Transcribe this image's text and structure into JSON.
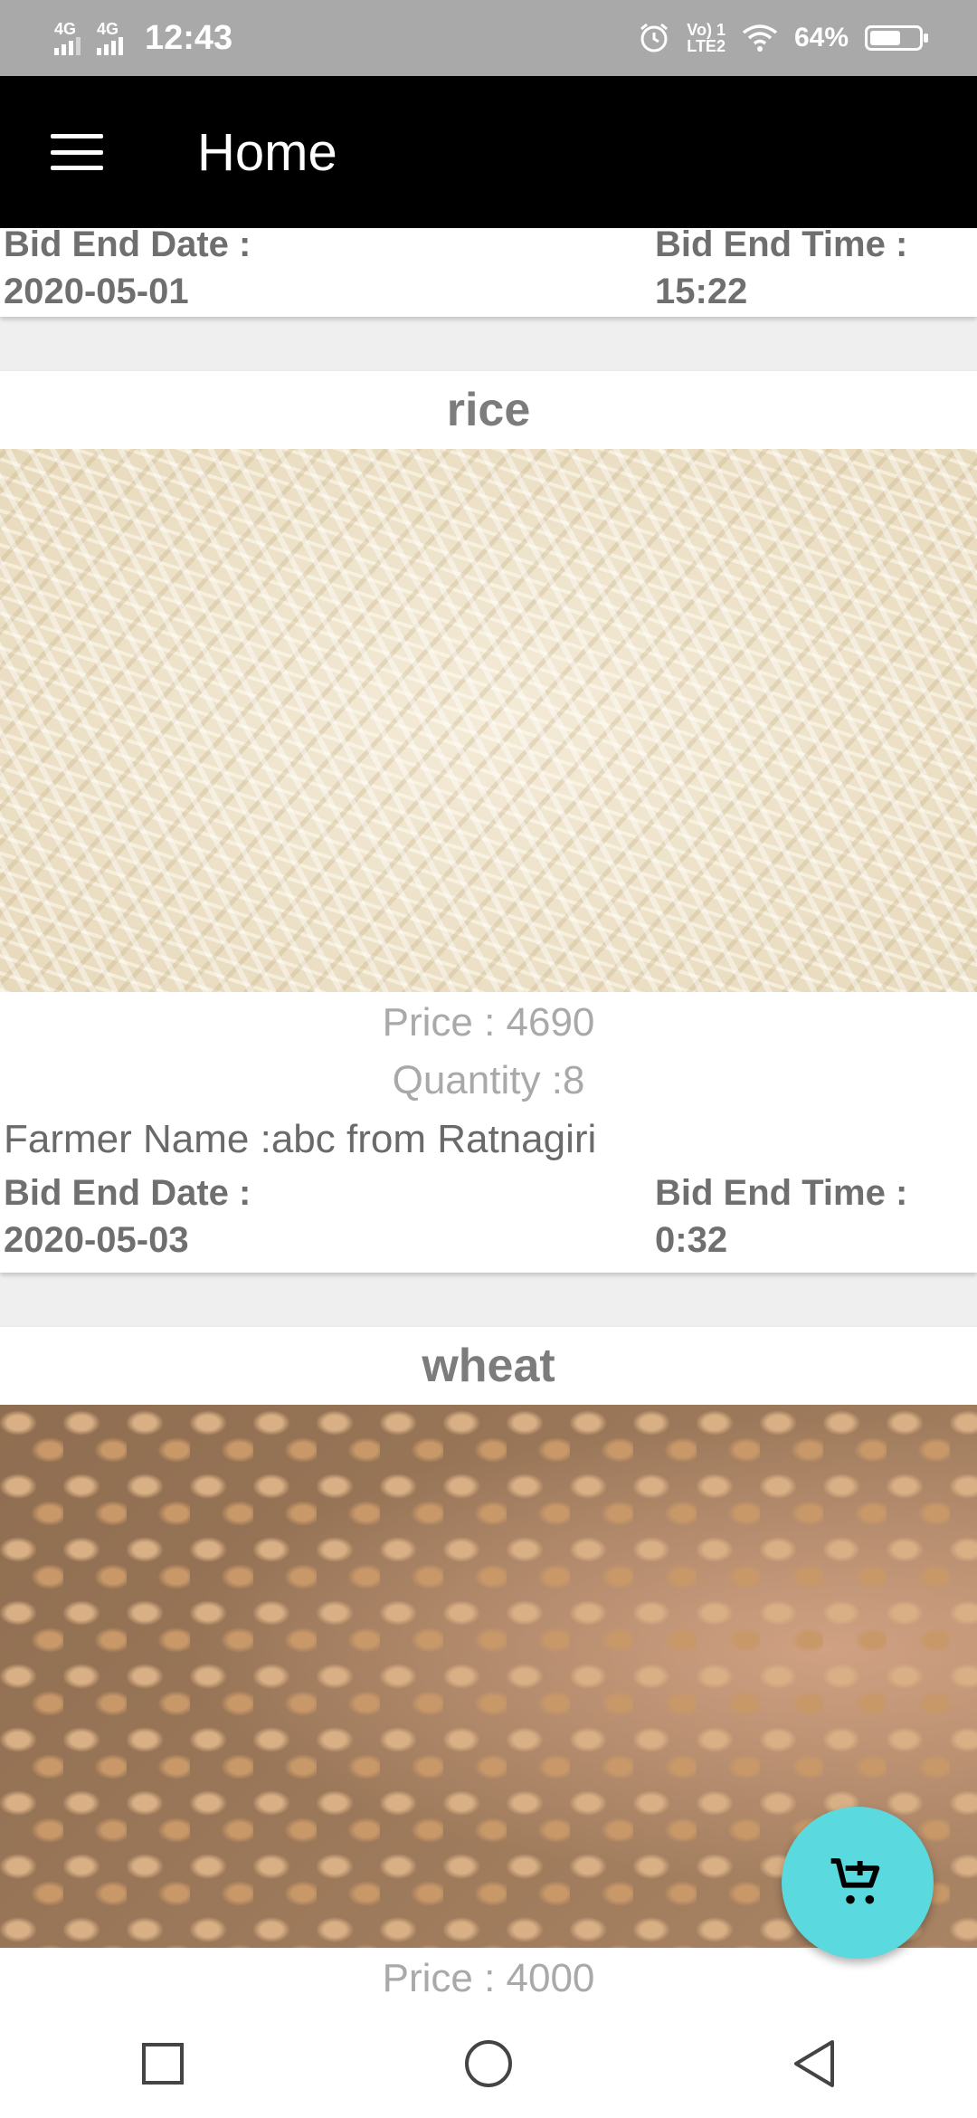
{
  "status_bar": {
    "network1": "4G",
    "network2": "4G",
    "time": "12:43",
    "volte_top": "Vo) 1",
    "volte_bottom": "LTE2",
    "battery_percent": "64%",
    "battery_level": 0.64
  },
  "app_bar": {
    "title": "Home",
    "menu_icon": "menu-icon"
  },
  "top_card": {
    "bid_end_date_label": "Bid End Date :",
    "bid_end_date": "2020-05-01",
    "bid_end_time_label": "Bid End Time :",
    "bid_end_time": "15:22"
  },
  "products": [
    {
      "name": "rice",
      "price": "Price : 4690",
      "quantity": "Quantity :8",
      "farmer": "Farmer Name :abc from Ratnagiri",
      "bid_end_date_label": "Bid End Date :",
      "bid_end_date": "2020-05-03",
      "bid_end_time_label": "Bid End Time :",
      "bid_end_time": "0:32"
    },
    {
      "name": "wheat",
      "price": "Price : 4000"
    }
  ],
  "fab": {
    "icon": "cart-add-icon",
    "color": "#5ad9df"
  },
  "nav_bar": {
    "recents_icon": "square-icon",
    "home_icon": "circle-icon",
    "back_icon": "triangle-back-icon"
  },
  "colors": {
    "status_bar": "#a9a9a9",
    "app_bar": "#000000",
    "background": "#efefef",
    "title_text": "#7c7c7c",
    "muted_text": "#a9a9a9"
  }
}
